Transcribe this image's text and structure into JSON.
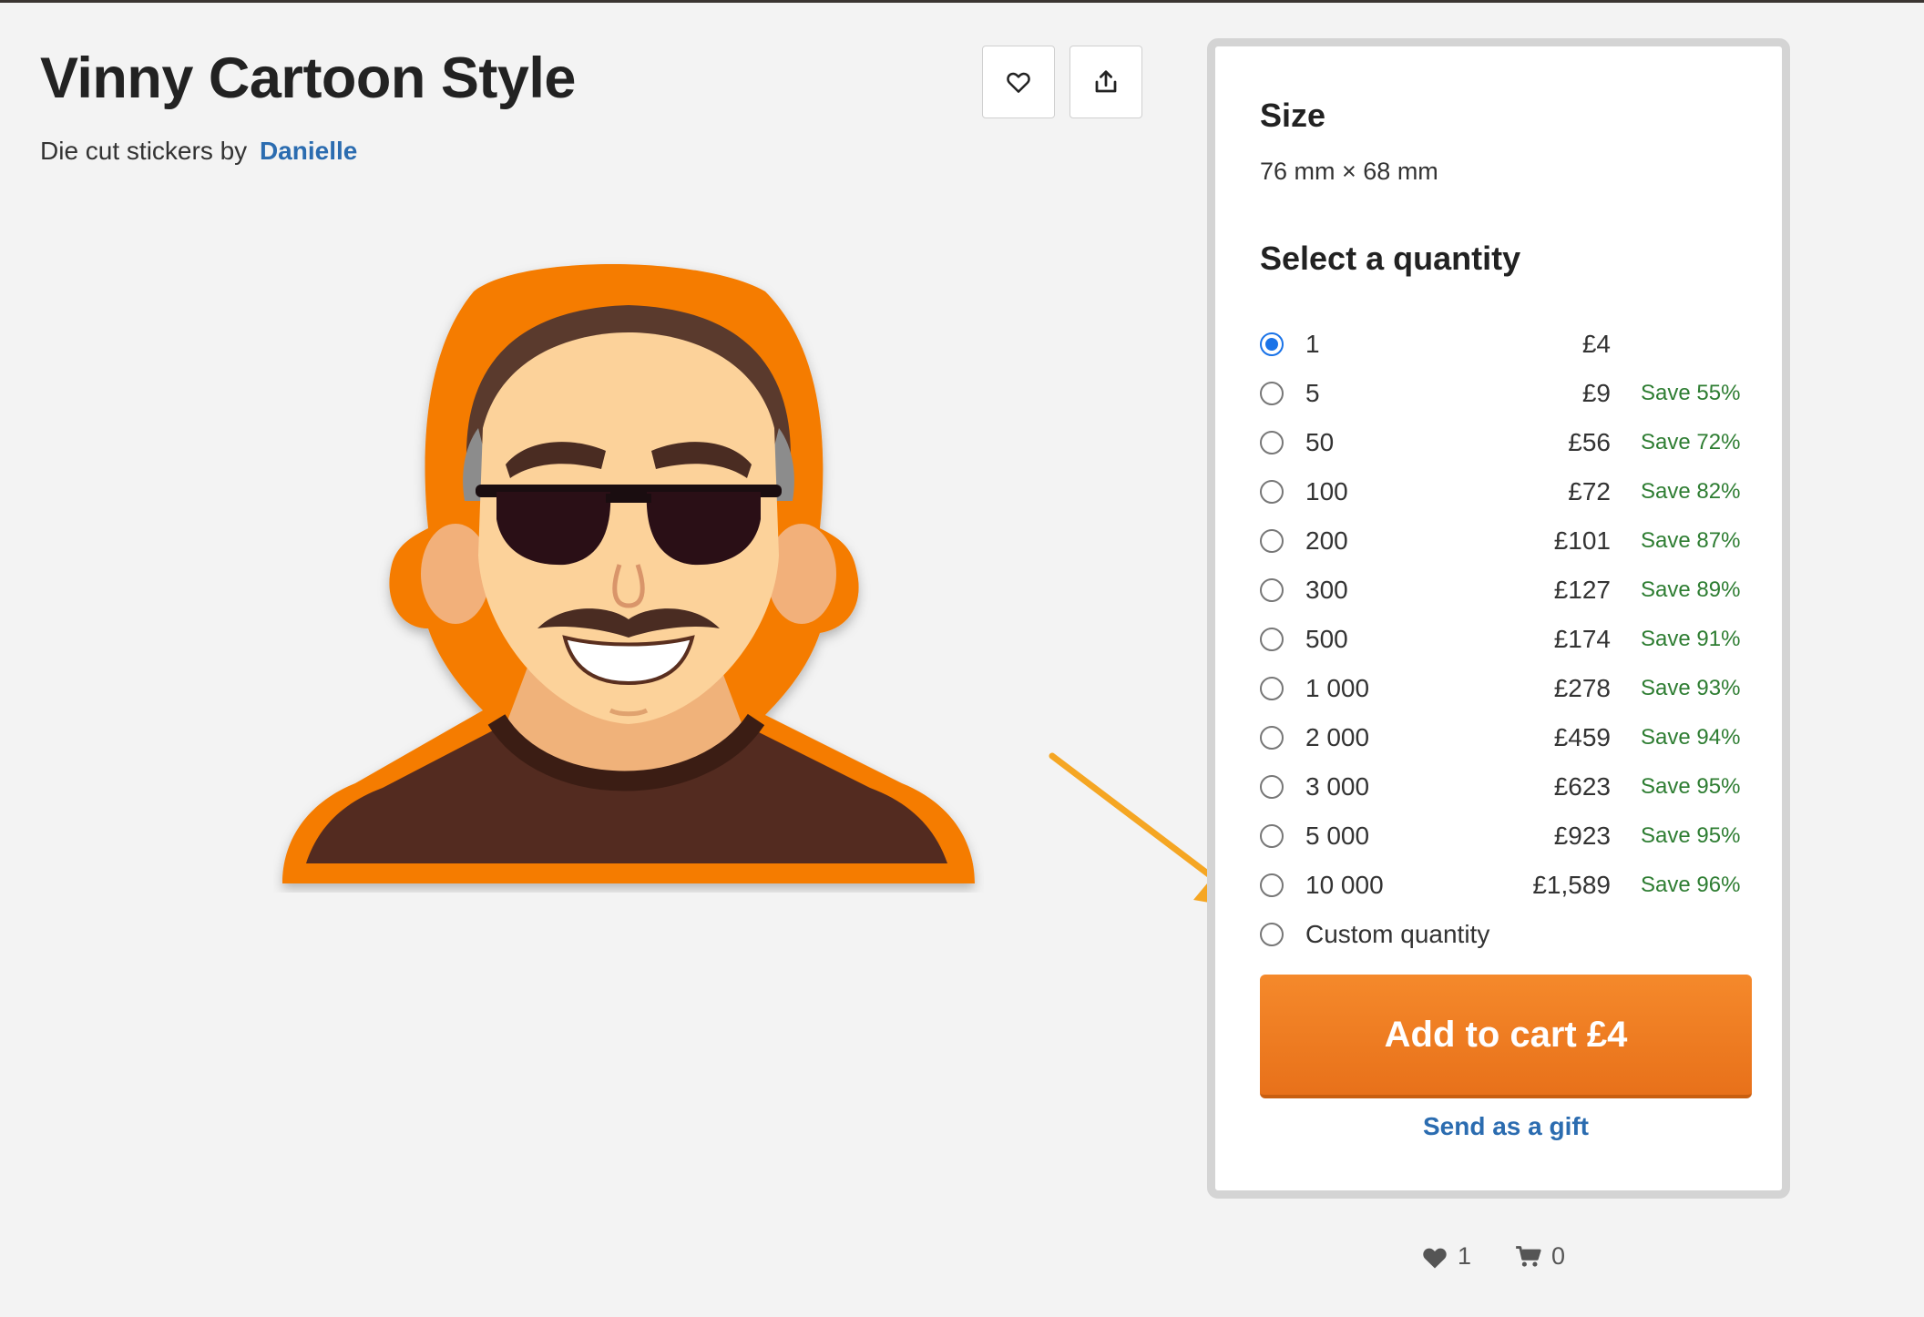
{
  "product": {
    "title": "Vinny Cartoon Style",
    "byline_prefix": "Die cut stickers by",
    "author": "Danielle"
  },
  "actions": {
    "favorite_icon": "heart-outline-icon",
    "share_icon": "share-icon"
  },
  "panel": {
    "size_heading": "Size",
    "size_value": "76 mm × 68 mm",
    "quantity_heading": "Select a quantity",
    "options": [
      {
        "qty": "1",
        "price": "£4",
        "save": "",
        "selected": true
      },
      {
        "qty": "5",
        "price": "£9",
        "save": "Save 55%"
      },
      {
        "qty": "50",
        "price": "£56",
        "save": "Save 72%"
      },
      {
        "qty": "100",
        "price": "£72",
        "save": "Save 82%"
      },
      {
        "qty": "200",
        "price": "£101",
        "save": "Save 87%"
      },
      {
        "qty": "300",
        "price": "£127",
        "save": "Save 89%"
      },
      {
        "qty": "500",
        "price": "£174",
        "save": "Save 91%"
      },
      {
        "qty": "1 000",
        "price": "£278",
        "save": "Save 93%"
      },
      {
        "qty": "2 000",
        "price": "£459",
        "save": "Save 94%"
      },
      {
        "qty": "3 000",
        "price": "£623",
        "save": "Save 95%"
      },
      {
        "qty": "5 000",
        "price": "£923",
        "save": "Save 95%"
      },
      {
        "qty": "10 000",
        "price": "£1,589",
        "save": "Save 96%"
      },
      {
        "qty": "Custom quantity",
        "price": "",
        "save": ""
      }
    ],
    "add_to_cart_label": "Add to cart £4",
    "gift_label": "Send as a gift"
  },
  "stats": {
    "likes": "1",
    "carts": "0"
  },
  "colors": {
    "accent": "#f0791f",
    "link": "#2b6cb0",
    "save": "#2e7d32",
    "radio": "#1a73e8",
    "annotation_arrow": "#f5a623"
  }
}
